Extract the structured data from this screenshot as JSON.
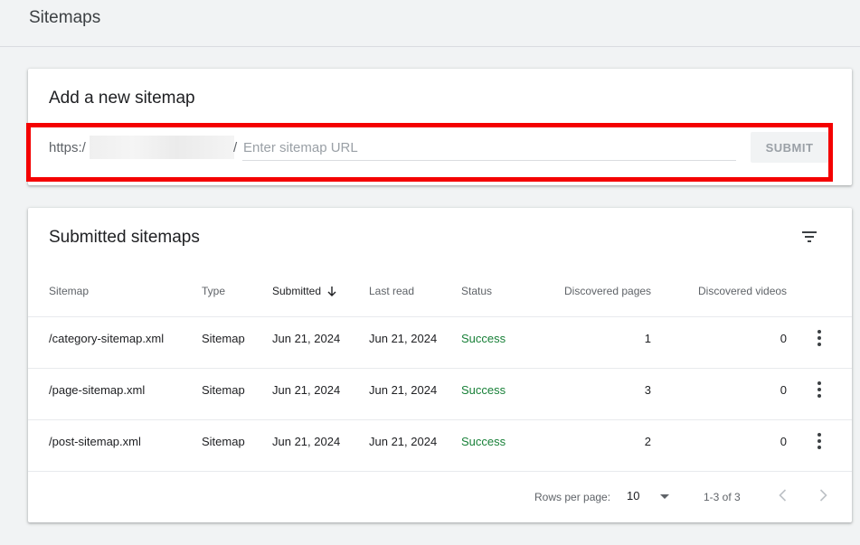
{
  "page": {
    "title": "Sitemaps"
  },
  "add_card": {
    "title": "Add a new sitemap",
    "url_prefix": "https:/",
    "url_separator": "/",
    "input_placeholder": "Enter sitemap URL",
    "input_value": "",
    "submit_label": "SUBMIT",
    "highlight_color": "#f40000"
  },
  "submitted_card": {
    "title": "Submitted sitemaps",
    "filter_icon": "filter-icon",
    "columns": {
      "sitemap": "Sitemap",
      "type": "Type",
      "submitted": "Submitted",
      "last_read": "Last read",
      "status": "Status",
      "discovered_pages": "Discovered pages",
      "discovered_videos": "Discovered videos"
    },
    "rows": [
      {
        "sitemap": "/category-sitemap.xml",
        "type": "Sitemap",
        "submitted": "Jun 21, 2024",
        "last_read": "Jun 21, 2024",
        "status": "Success",
        "pages": "1",
        "videos": "0"
      },
      {
        "sitemap": "/page-sitemap.xml",
        "type": "Sitemap",
        "submitted": "Jun 21, 2024",
        "last_read": "Jun 21, 2024",
        "status": "Success",
        "pages": "3",
        "videos": "0"
      },
      {
        "sitemap": "/post-sitemap.xml",
        "type": "Sitemap",
        "submitted": "Jun 21, 2024",
        "last_read": "Jun 21, 2024",
        "status": "Success",
        "pages": "2",
        "videos": "0"
      }
    ],
    "pagination": {
      "rows_per_page_label": "Rows per page:",
      "rows_per_page_value": "10",
      "range_label": "1-3 of 3"
    }
  },
  "colors": {
    "success": "#188038",
    "accent": "#1a73e8"
  }
}
